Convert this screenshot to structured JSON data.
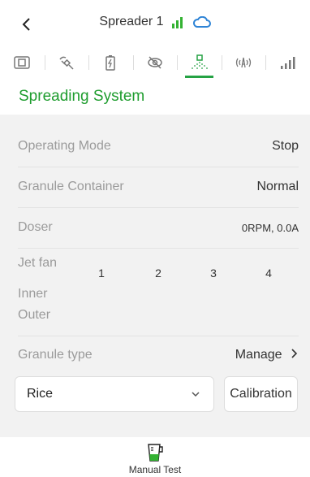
{
  "header": {
    "title": "Spreader 1",
    "back_label": "<"
  },
  "tabs": [
    {
      "name": "device-icon",
      "active": false
    },
    {
      "name": "satellite-icon",
      "active": false
    },
    {
      "name": "battery-icon",
      "active": false
    },
    {
      "name": "eye-off-icon",
      "active": false
    },
    {
      "name": "spreading-icon",
      "active": true
    },
    {
      "name": "antenna-icon",
      "active": false
    },
    {
      "name": "signal-icon",
      "active": false
    }
  ],
  "section": {
    "title": "Spreading System"
  },
  "rows": {
    "operating_mode": {
      "label": "Operating Mode",
      "value": "Stop"
    },
    "granule_container": {
      "label": "Granule Container",
      "value": "Normal"
    },
    "doser": {
      "label": "Doser",
      "value": "0RPM, 0.0A"
    }
  },
  "jet_fan": {
    "label": "Jet fan",
    "columns": [
      "1",
      "2",
      "3",
      "4"
    ],
    "inner_label": "Inner",
    "outer_label": "Outer"
  },
  "granule": {
    "label": "Granule type",
    "manage_label": "Manage",
    "selected": "Rice",
    "calibration_label": "Calibration"
  },
  "footer": {
    "label": "Manual Test"
  },
  "colors": {
    "accent": "#1f9d2f",
    "cloud": "#2f84d6"
  }
}
